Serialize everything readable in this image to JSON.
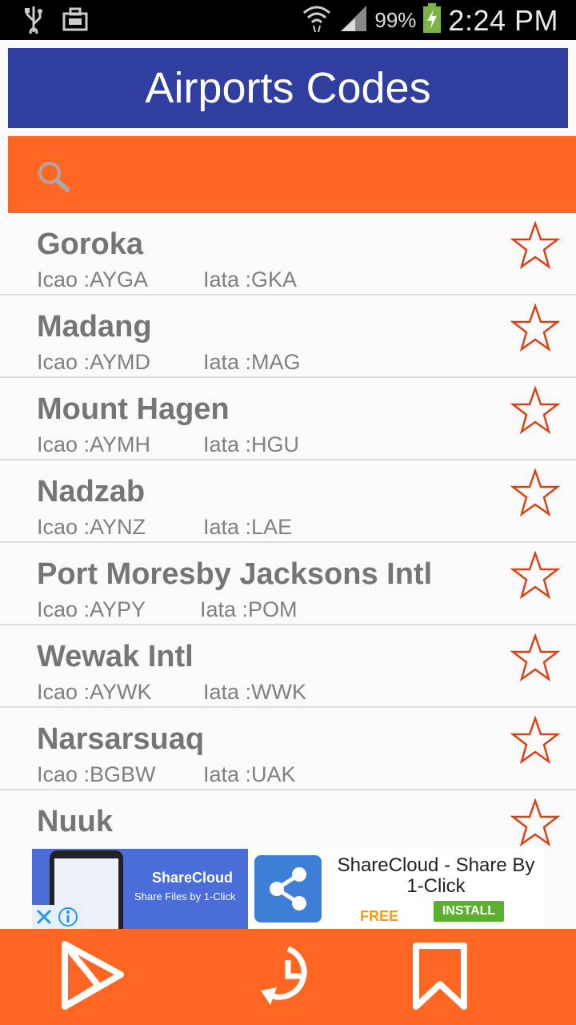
{
  "status_bar": {
    "battery_percent": "99%",
    "time": "2:24 PM"
  },
  "app": {
    "title": "Airports Codes"
  },
  "search": {
    "placeholder": "",
    "value": ""
  },
  "airports": [
    {
      "name": "Goroka",
      "icao": "Icao :AYGA",
      "iata": "Iata :GKA"
    },
    {
      "name": "Madang",
      "icao": "Icao :AYMD",
      "iata": "Iata :MAG"
    },
    {
      "name": "Mount Hagen",
      "icao": "Icao :AYMH",
      "iata": "Iata :HGU"
    },
    {
      "name": "Nadzab",
      "icao": "Icao :AYNZ",
      "iata": "Iata :LAE"
    },
    {
      "name": "Port Moresby Jacksons Intl",
      "icao": "Icao :AYPY",
      "iata": "Iata :POM"
    },
    {
      "name": "Wewak Intl",
      "icao": "Icao :AYWK",
      "iata": "Iata :WWK"
    },
    {
      "name": "Narsarsuaq",
      "icao": "Icao :BGBW",
      "iata": "Iata :UAK"
    },
    {
      "name": "Nuuk",
      "icao": "",
      "iata": ""
    }
  ],
  "ad": {
    "promo_title": "ShareCloud",
    "promo_subtitle": "Share Files by 1-Click",
    "app_name": "ShareCloud - Share By 1-Click",
    "price": "FREE",
    "install_label": "INSTALL"
  },
  "colors": {
    "title_bar": "#303f9f",
    "accent": "#ff6622",
    "star": "#d84315"
  }
}
